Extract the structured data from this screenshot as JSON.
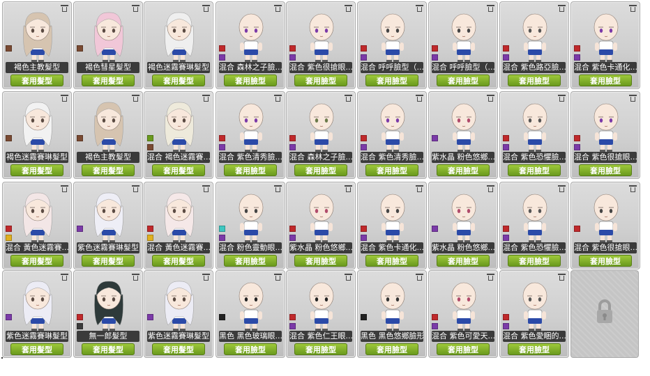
{
  "colors": {
    "accent_button": "#7fb02a",
    "label_bg": "#3b3b3b",
    "card_bg": "#cfcfcf"
  },
  "lock_icon": "padlock-icon",
  "rows": [
    [
      {
        "kind": "hair",
        "name": "褐色主教髮型",
        "button": "套用髮型",
        "swatches": [
          "#7a4a32"
        ],
        "hair": "#d6c4b0"
      },
      {
        "kind": "hair",
        "name": "褐色彗星髮型",
        "button": "套用髮型",
        "swatches": [
          "#7a4a32"
        ],
        "hair": "#f1c7d8"
      },
      {
        "kind": "hair",
        "name": "褐色迷霧賽琳髮型",
        "button": "套用髮型",
        "swatches": [],
        "hair": "#efefef"
      },
      {
        "kind": "face",
        "name": "混合 森林之子臉...",
        "button": "套用臉型",
        "swatches": [
          "#c0292b",
          "#7b3aa8"
        ],
        "eye": "#7b3aa8"
      },
      {
        "kind": "face",
        "name": "混合 紫色很搶眼...",
        "button": "套用臉型",
        "swatches": [
          "#c0292b",
          "#7b3aa8"
        ],
        "eye": "#7b3aa8"
      },
      {
        "kind": "face",
        "name": "混合 呼呼臉型（...",
        "button": "套用臉型",
        "swatches": [
          "#c0292b",
          "#7b3aa8"
        ],
        "eye": "#444444"
      },
      {
        "kind": "face",
        "name": "混合 呼呼臉型（...",
        "button": "套用臉型",
        "swatches": [
          "#c0292b",
          "#7b3aa8"
        ],
        "eye": "#444444"
      },
      {
        "kind": "face",
        "name": "混合 紫色路亞臉...",
        "button": "套用臉型",
        "swatches": [
          "#c0292b",
          "#7b3aa8"
        ],
        "eye": "#555555"
      },
      {
        "kind": "face",
        "name": "混合 紫色卡通化...",
        "button": "套用臉型",
        "swatches": [
          "#c0292b",
          "#7b3aa8"
        ],
        "eye": "#7b3aa8"
      }
    ],
    [
      {
        "kind": "hair",
        "name": "褐色迷霧賽琳髮型",
        "button": "套用髮型",
        "swatches": [
          "#7a4a32"
        ],
        "hair": "#f2f2f2"
      },
      {
        "kind": "hair",
        "name": "褐色主教髮型",
        "button": "套用髮型",
        "swatches": [
          "#7a4a32"
        ],
        "hair": "#d6c4b0"
      },
      {
        "kind": "hair",
        "name": "混合 褐色迷霧賽...",
        "button": "套用髮型",
        "swatches": [
          "#6a9a1e",
          "#7a4a32"
        ],
        "hair": "#eeeadb"
      },
      {
        "kind": "face",
        "name": "混合 紫色清秀臉...",
        "button": "套用臉型",
        "swatches": [
          "#c0292b",
          "#7b3aa8"
        ],
        "eye": "#7b3aa8"
      },
      {
        "kind": "face",
        "name": "混合 森林之子臉...",
        "button": "套用臉型",
        "swatches": [
          "#c0292b",
          "#7b3aa8"
        ],
        "eye": "#6a7a4a"
      },
      {
        "kind": "face",
        "name": "混合 紫色清秀臉...",
        "button": "套用臉型",
        "swatches": [
          "#c0292b",
          "#7b3aa8"
        ],
        "eye": "#7b3aa8"
      },
      {
        "kind": "face",
        "name": "紫水晶 粉色悠鄉...",
        "button": "套用臉型",
        "swatches": [
          "#7b3aa8"
        ],
        "eye": "#b04a6a"
      },
      {
        "kind": "face",
        "name": "混合 紫色恐懼臉...",
        "button": "套用臉型",
        "swatches": [
          "#c0292b",
          "#7b3aa8"
        ],
        "eye": "#555555"
      },
      {
        "kind": "face",
        "name": "混合 紫色很搶眼...",
        "button": "套用臉型",
        "swatches": [
          "#c0292b",
          "#7b3aa8"
        ],
        "eye": "#7b3aa8"
      }
    ],
    [
      {
        "kind": "hair",
        "name": "混合 黃色迷霧賽...",
        "button": "套用髮型",
        "swatches": [
          "#c0292b",
          "#e0b020"
        ],
        "hair": "#f3e6e6"
      },
      {
        "kind": "hair",
        "name": "紫色迷霧賽琳髮型",
        "button": "套用髮型",
        "swatches": [
          "#7b3aa8"
        ],
        "hair": "#eeeef6"
      },
      {
        "kind": "hair",
        "name": "混合 黃色迷霧賽...",
        "button": "套用髮型",
        "swatches": [
          "#c0292b",
          "#e0b020"
        ],
        "hair": "#f5e8e8"
      },
      {
        "kind": "face",
        "name": "混合 粉色靈動眼...",
        "button": "套用臉型",
        "swatches": [
          "#3ec7c0",
          "#7b3aa8"
        ],
        "eye": "#444444"
      },
      {
        "kind": "face",
        "name": "紫水晶 粉色悠鄉...",
        "button": "套用臉型",
        "swatches": [
          "#c0292b",
          "#7b3aa8"
        ],
        "eye": "#b04a6a"
      },
      {
        "kind": "face",
        "name": "混合 紫色卡通化...",
        "button": "套用臉型",
        "swatches": [
          "#c0292b",
          "#7b3aa8"
        ],
        "eye": "#444444"
      },
      {
        "kind": "face",
        "name": "紫水晶 粉色悠鄉...",
        "button": "套用臉型",
        "swatches": [
          "#7b3aa8"
        ],
        "eye": "#b04a6a"
      },
      {
        "kind": "face",
        "name": "混合 紫色恐懼臉...",
        "button": "套用臉型",
        "swatches": [
          "#c0292b",
          "#7b3aa8"
        ],
        "eye": "#555555"
      },
      {
        "kind": "face",
        "name": "混合 紫色很搶眼...",
        "button": "套用臉型",
        "swatches": [
          "#c0292b"
        ],
        "eye": "#444444"
      }
    ],
    [
      {
        "kind": "hair",
        "name": "紫色迷霧賽琳髮型",
        "button": "套用髮型",
        "swatches": [
          "#7b3aa8"
        ],
        "hair": "#ececf5"
      },
      {
        "kind": "hair",
        "name": "無一郎髮型",
        "button": "套用髮型",
        "swatches": [
          "#c0292b",
          "#3b3b3b"
        ],
        "hair": "#2e3a3a"
      },
      {
        "kind": "hair",
        "name": "紫色迷霧賽琳髮型",
        "button": "套用髮型",
        "swatches": [
          "#7b3aa8"
        ],
        "hair": "#ececf5"
      },
      {
        "kind": "face",
        "name": "黑色 黑色玻璃眼...",
        "button": "套用臉型",
        "swatches": [
          "#222222"
        ],
        "eye": "#222222"
      },
      {
        "kind": "face",
        "name": "混合 紫色仁王眼...",
        "button": "套用臉型",
        "swatches": [
          "#c0292b",
          "#7b3aa8"
        ],
        "eye": "#222222"
      },
      {
        "kind": "face",
        "name": "黑色 黑色悠鄉臉形",
        "button": "套用臉型",
        "swatches": [
          "#222222"
        ],
        "eye": "#333333"
      },
      {
        "kind": "face",
        "name": "混合 紫色可愛天...",
        "button": "套用臉型",
        "swatches": [
          "#c0292b",
          "#7b3aa8"
        ],
        "eye": "#b04a6a"
      },
      {
        "kind": "face",
        "name": "混合 紫色愛睏的...",
        "button": "套用臉型",
        "swatches": [
          "#c0292b",
          "#7b3aa8"
        ],
        "eye": "#555555"
      }
    ]
  ]
}
